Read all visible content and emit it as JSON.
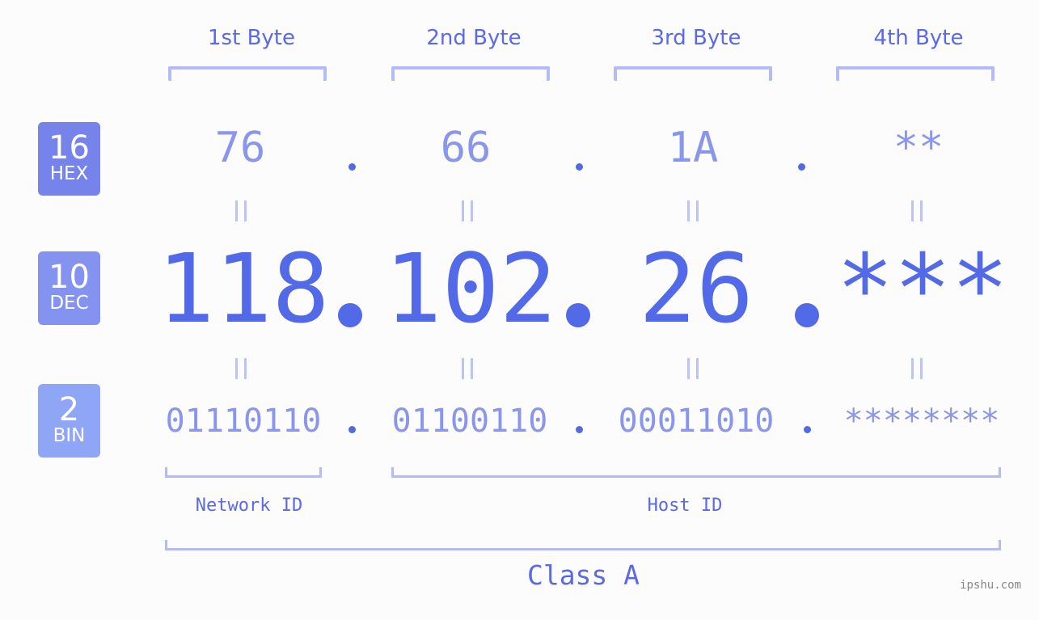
{
  "colors": {
    "accent": "#5269e8",
    "hex_badge": "#7583ea",
    "dec_badge": "#8492f0",
    "bin_badge": "#8fa5f6",
    "bracket": "#b3bcf6",
    "light_value": "#8a96ec"
  },
  "bytes": [
    {
      "label": "1st Byte",
      "hex": "76",
      "dec": "118",
      "bin": "01110110"
    },
    {
      "label": "2nd Byte",
      "hex": "66",
      "dec": "102",
      "bin": "01100110"
    },
    {
      "label": "3rd Byte",
      "hex": "1A",
      "dec": "26",
      "bin": "00011010"
    },
    {
      "label": "4th Byte",
      "hex": "**",
      "dec": "***",
      "bin": "********"
    }
  ],
  "badges": {
    "hex": {
      "number": "16",
      "label": "HEX",
      "icon": "hex-base-badge"
    },
    "dec": {
      "number": "10",
      "label": "DEC",
      "icon": "dec-base-badge"
    },
    "bin": {
      "number": "2",
      "label": "BIN",
      "icon": "bin-base-badge"
    }
  },
  "separator": ".",
  "equals_icon": "equals-icon",
  "network_id_label": "Network ID",
  "host_id_label": "Host ID",
  "class_label": "Class A",
  "watermark": "ipshu.com"
}
